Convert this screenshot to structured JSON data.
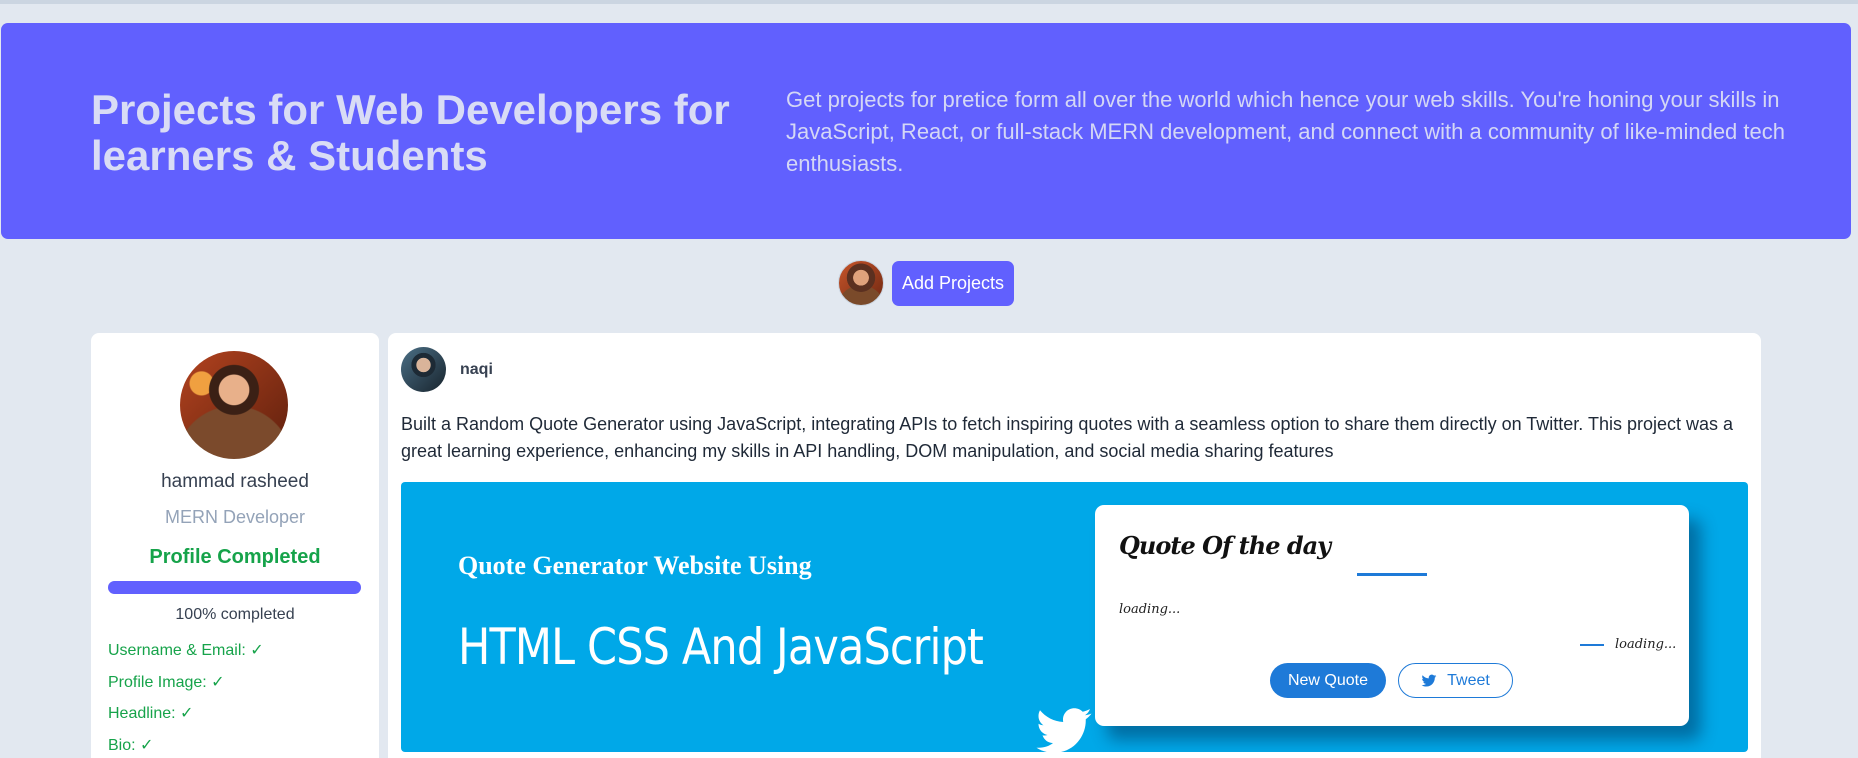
{
  "hero": {
    "title": "Projects for Web Developers for learners & Students",
    "description": "Get projects for pretice form all over the world which hence your web skills. You're honing your skills in JavaScript, React, or full-stack MERN development, and connect with a community of like-minded tech enthusiasts."
  },
  "actions": {
    "add_projects_label": "Add Projects"
  },
  "profile": {
    "name": "hammad rasheed",
    "role": "MERN Developer",
    "status": "Profile Completed",
    "progress_percent": 100,
    "progress_label": "100% completed",
    "checklist": [
      "Username & Email: ✓",
      "Profile Image: ✓",
      "Headline: ✓",
      "Bio: ✓"
    ]
  },
  "post": {
    "author": "naqi",
    "text": "Built a Random Quote Generator using JavaScript, integrating APIs to fetch inspiring quotes with a seamless option to share them directly on Twitter. This project was a great learning experience, enhancing my skills in API handling, DOM manipulation, and social media sharing features",
    "thumbnail": {
      "subtitle": "Quote Generator Website Using",
      "headline": "HTML CSS And JavaScript",
      "quote_title": "Quote Of the day",
      "quote_text": "loading...",
      "quote_author": "loading...",
      "new_quote_label": "New Quote",
      "tweet_label": "Tweet"
    }
  },
  "colors": {
    "accent": "#6160fe",
    "background": "#e2e8f0",
    "success": "#16a34a",
    "thumbnail_bg": "#00a8e8",
    "twitter_blue": "#1e7ad8"
  }
}
